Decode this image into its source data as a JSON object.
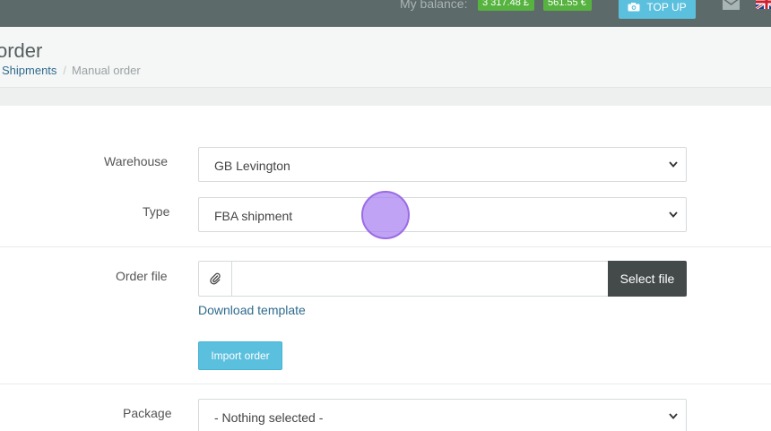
{
  "topbar": {
    "balance_label": "My balance:",
    "balance_gbp": "3 317.48 £",
    "balance_eur": "561.55 €",
    "topup_label": "TOP UP",
    "icons": [
      "camera-icon",
      "mail-icon",
      "uk-flag-icon"
    ]
  },
  "header": {
    "title": "order",
    "breadcrumb": {
      "link": "Shipments",
      "separator": "/",
      "current": "Manual order"
    }
  },
  "form": {
    "warehouse": {
      "label": "Warehouse",
      "value": "GB Levington"
    },
    "type": {
      "label": "Type",
      "value": "FBA shipment"
    },
    "order_file": {
      "label": "Order file",
      "value": "",
      "select_label": "Select file",
      "download_label": "Download template",
      "import_label": "Import order"
    },
    "package": {
      "label": "Package",
      "value": "- Nothing selected -"
    }
  },
  "colors": {
    "topbar": "#5d6a6a",
    "badge": "#56b33f",
    "accent": "#5bc0de",
    "link": "#2e6b8d",
    "dark_button": "#444a4a",
    "cursor": "#a880f0"
  }
}
